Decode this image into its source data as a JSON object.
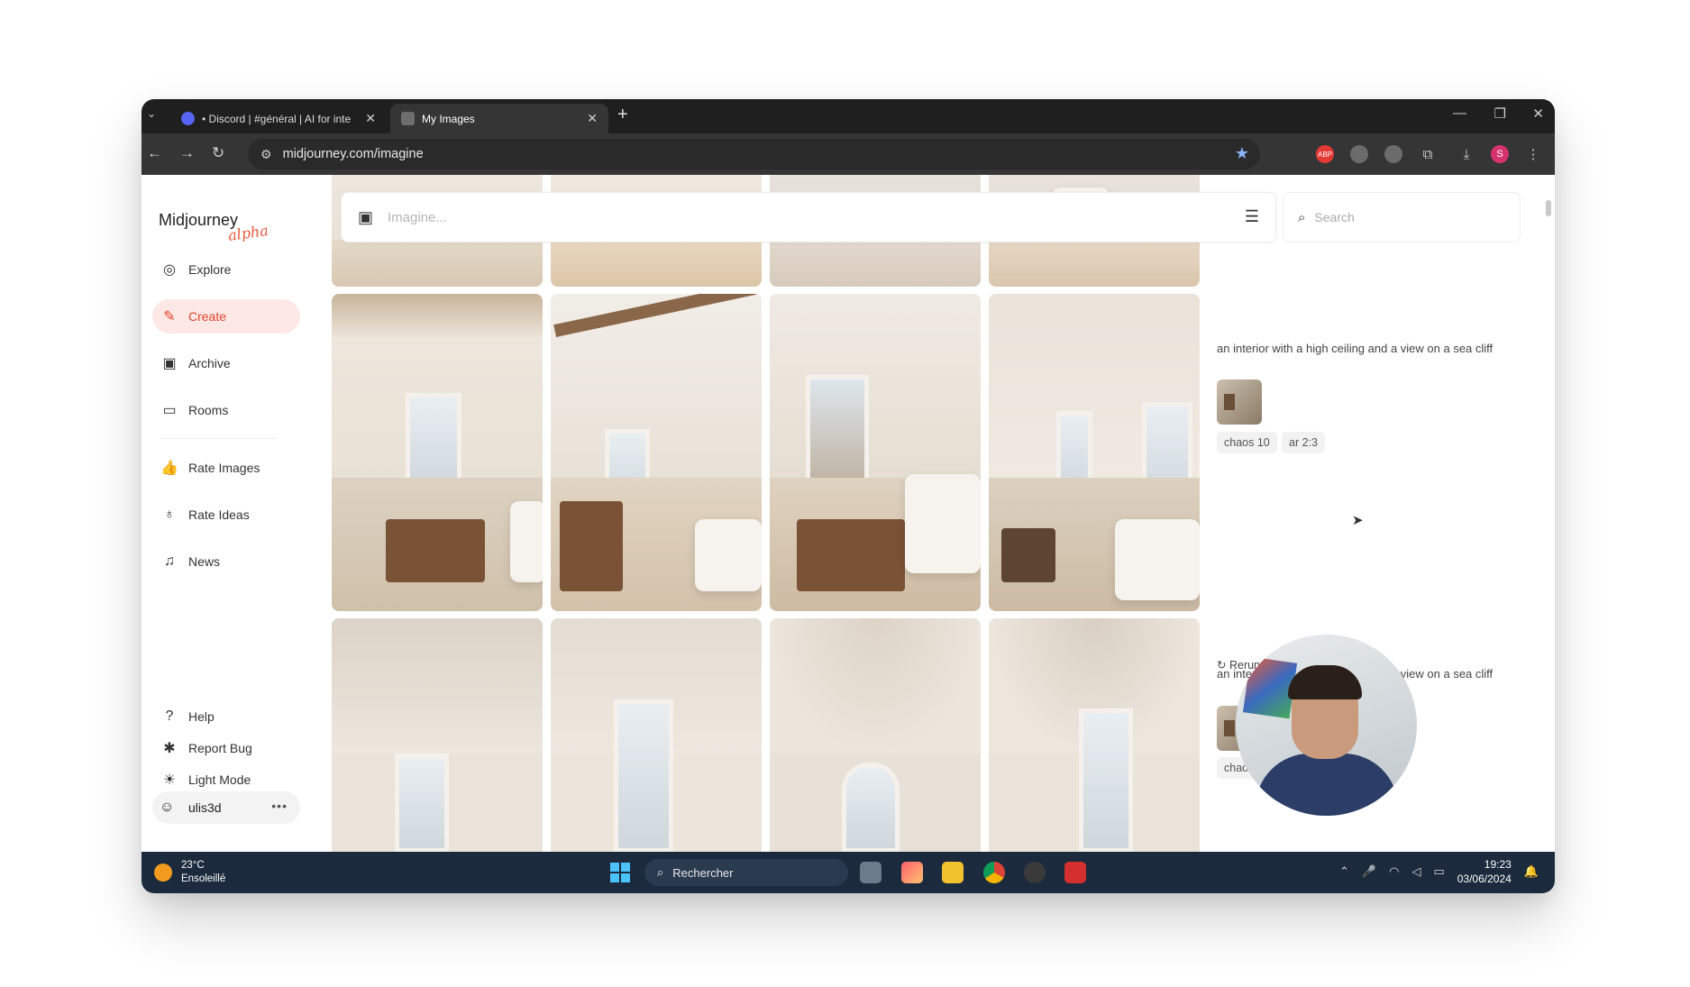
{
  "browser": {
    "tabs": [
      {
        "label": "• Discord | #général | AI for inte",
        "close": "✕"
      },
      {
        "label": "My Images",
        "close": "✕"
      }
    ],
    "new_tab": "+",
    "url": "midjourney.com/imagine",
    "window_controls": [
      "—",
      "❐",
      "✕"
    ],
    "extensions": [
      {
        "name": "adblock-icon",
        "label": "ABP",
        "color": "#e53935"
      },
      {
        "name": "camera-icon",
        "label": "",
        "color": "#6b6b6b"
      },
      {
        "name": "circle-extension-icon",
        "label": "",
        "color": "#6b6b6b"
      },
      {
        "name": "puzzle-icon",
        "label": "",
        "color": "#353535"
      },
      {
        "name": "download-icon",
        "label": "",
        "color": "#353535"
      },
      {
        "name": "profile-avatar",
        "label": "S",
        "color": "#d6336c"
      }
    ]
  },
  "sidebar": {
    "logo": "Midjourney",
    "logo_tag": "alpha",
    "items": [
      {
        "name": "explore",
        "label": "Explore",
        "icon": "compass-icon",
        "active": false
      },
      {
        "name": "create",
        "label": "Create",
        "icon": "brush-icon",
        "active": true
      },
      {
        "name": "archive",
        "label": "Archive",
        "icon": "image-icon",
        "active": false
      },
      {
        "name": "rooms",
        "label": "Rooms",
        "icon": "chat-icon",
        "active": false
      },
      {
        "name": "rate-images",
        "label": "Rate Images",
        "icon": "thumbs-up-icon",
        "active": false
      },
      {
        "name": "rate-ideas",
        "label": "Rate Ideas",
        "icon": "lightbulb-icon",
        "active": false
      },
      {
        "name": "news",
        "label": "News",
        "icon": "bell-icon",
        "active": false
      }
    ],
    "bottom_items": [
      {
        "name": "help",
        "label": "Help",
        "icon": "question-icon"
      },
      {
        "name": "report-bug",
        "label": "Report Bug",
        "icon": "bug-icon"
      },
      {
        "name": "light-mode",
        "label": "Light Mode",
        "icon": "sun-icon"
      }
    ],
    "user": "ulis3d",
    "user_menu": "•••"
  },
  "imagine_bar": {
    "placeholder": "Imagine..."
  },
  "search": {
    "placeholder": "Search"
  },
  "prompts": [
    {
      "text": "an interior with a high ceiling and a view on a sea cliff",
      "tags": [
        "chaos 10",
        "ar 2:3"
      ]
    },
    {
      "text": "an interior with a high ceiling and a view on a sea cliff",
      "tags": [
        "chaos 10"
      ]
    }
  ],
  "rerun_label": "Rerun",
  "taskbar": {
    "temperature": "23°C",
    "weather": "Ensoleillé",
    "search_placeholder": "Rechercher",
    "time": "19:23",
    "date": "03/06/2024"
  },
  "colors": {
    "accent": "#e2452b",
    "accent_bg": "#fde8e6",
    "taskbar": "#1b2a3c"
  }
}
